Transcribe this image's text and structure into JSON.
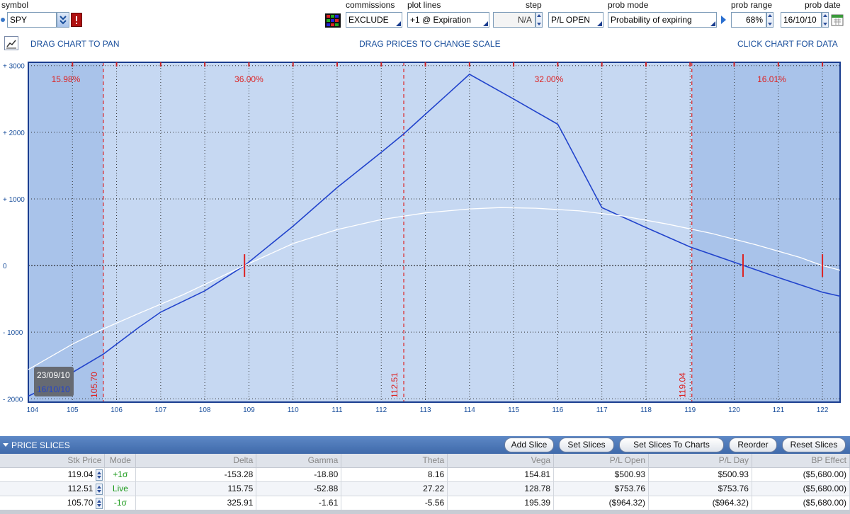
{
  "toolbar": {
    "symbol_label": "symbol",
    "symbol_value": "SPY",
    "commissions_label": "commissions",
    "commissions_value": "EXCLUDE",
    "plot_lines_label": "plot lines",
    "plot_lines_value": "+1 @ Expiration",
    "step_label": "step",
    "step_value": "N/A",
    "mode_value": "P/L OPEN",
    "prob_mode_label": "prob mode",
    "prob_mode_value": "Probability of expiring",
    "prob_range_label": "prob range",
    "prob_range_value": "68%",
    "prob_date_label": "prob date",
    "prob_date_value": "16/10/10"
  },
  "chart_header": {
    "left": "DRAG CHART TO PAN",
    "center": "DRAG PRICES TO CHANGE SCALE",
    "right": "CLICK CHART FOR DATA"
  },
  "colors": {
    "plot_bg": "#c6d8f2",
    "tail_bg": "#a9c3ea",
    "expiration_line": "#2244cc",
    "today_line": "#ffffff",
    "marker": "#dd2222",
    "axis_text": "#1a4f9c"
  },
  "chart_data": {
    "type": "line",
    "xlim": [
      104,
      122.4
    ],
    "ylim": [
      -2050,
      3050
    ],
    "x_ticks": [
      104,
      105,
      106,
      107,
      108,
      109,
      110,
      111,
      112,
      113,
      114,
      115,
      116,
      117,
      118,
      119,
      120,
      121,
      122
    ],
    "y_ticks": [
      -2000,
      -1000,
      0,
      1000,
      2000,
      3000
    ],
    "y_tick_labels": [
      "- 2000",
      "- 1000",
      "0",
      "+ 1000",
      "+ 2000",
      "+ 3000"
    ],
    "grid": true,
    "series": [
      {
        "x": [
          104,
          104.5,
          105.7,
          106.5,
          107,
          108,
          108.9,
          110,
          111,
          112,
          112.5,
          113,
          113.5,
          114,
          115,
          116,
          116.1,
          117,
          118,
          119,
          120,
          121,
          122,
          122.4
        ],
        "y": [
          -1960,
          -1800,
          -1330,
          -930,
          -700,
          -380,
          0,
          590,
          1170,
          1700,
          1970,
          2270,
          2570,
          2870,
          2500,
          2120,
          2000,
          870,
          570,
          280,
          50,
          -180,
          -400,
          -460
        ]
      },
      {
        "x": [
          104,
          105,
          105.7,
          106.5,
          107.5,
          108.9,
          110,
          111,
          112,
          113,
          114,
          114.7,
          115.5,
          116.5,
          117.5,
          118.5,
          119.5,
          120.5,
          121.5,
          122,
          122.4
        ],
        "y": [
          -1560,
          -1180,
          -950,
          -720,
          -440,
          0,
          330,
          540,
          690,
          790,
          850,
          870,
          860,
          820,
          740,
          620,
          480,
          310,
          120,
          0,
          -70
        ]
      }
    ],
    "sigma_lines": [
      {
        "x": 105.7,
        "label": "105.70"
      },
      {
        "x": 112.51,
        "label": "112.51"
      },
      {
        "x": 119.04,
        "label": "119.04"
      }
    ],
    "prob_regions": [
      {
        "x": 104.85,
        "label": "15.98%"
      },
      {
        "x": 109.0,
        "label": "36.00%"
      },
      {
        "x": 115.8,
        "label": "32.00%"
      },
      {
        "x": 120.85,
        "label": "16.01%"
      }
    ],
    "breakevens": [
      108.9,
      120.2,
      122.0
    ],
    "date_labels": [
      "23/09/10",
      "16/10/10"
    ]
  },
  "price_slices": {
    "title": "PRICE SLICES",
    "buttons": [
      "Add Slice",
      "Set Slices",
      "Set Slices To Charts",
      "Reorder",
      "Reset Slices"
    ],
    "columns": [
      "Stk Price",
      "Mode",
      "Delta",
      "Gamma",
      "Theta",
      "Vega",
      "P/L Open",
      "P/L Day",
      "BP Effect"
    ],
    "rows": [
      [
        "119.04",
        "+1σ",
        "-153.28",
        "-18.80",
        "8.16",
        "154.81",
        "$500.93",
        "$500.93",
        "($5,680.00)"
      ],
      [
        "112.51",
        "Live",
        "115.75",
        "-52.88",
        "27.22",
        "128.78",
        "$753.76",
        "$753.76",
        "($5,680.00)"
      ],
      [
        "105.70",
        "-1σ",
        "325.91",
        "-1.61",
        "-5.56",
        "195.39",
        "($964.32)",
        "($964.32)",
        "($5,680.00)"
      ]
    ]
  }
}
